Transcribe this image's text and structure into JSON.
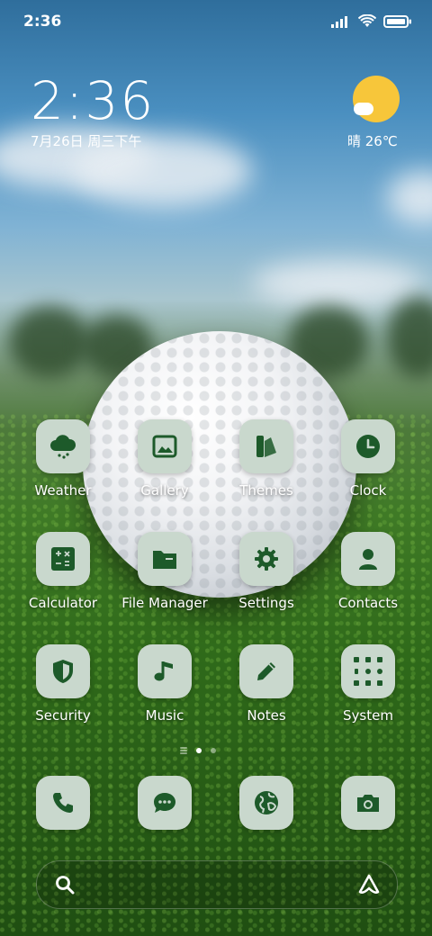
{
  "status_bar": {
    "time": "2:36"
  },
  "widget": {
    "time": "2:36",
    "date": "7月26日 周三下午",
    "weather": "晴 26℃"
  },
  "apps": [
    {
      "label": "Weather",
      "icon": "cloud-icon"
    },
    {
      "label": "Gallery",
      "icon": "image-icon"
    },
    {
      "label": "Themes",
      "icon": "palette-icon"
    },
    {
      "label": "Clock",
      "icon": "clock-icon"
    },
    {
      "label": "Calculator",
      "icon": "calculator-icon"
    },
    {
      "label": "File Manager",
      "icon": "folder-icon"
    },
    {
      "label": "Settings",
      "icon": "gear-icon"
    },
    {
      "label": "Contacts",
      "icon": "person-icon"
    },
    {
      "label": "Security",
      "icon": "shield-icon"
    },
    {
      "label": "Music",
      "icon": "music-note-icon"
    },
    {
      "label": "Notes",
      "icon": "pencil-icon"
    },
    {
      "label": "System",
      "icon": "app-folder-icon"
    }
  ],
  "dock": [
    {
      "name": "phone",
      "icon": "phone-icon"
    },
    {
      "name": "messages",
      "icon": "chat-icon"
    },
    {
      "name": "browser",
      "icon": "globe-icon"
    },
    {
      "name": "camera",
      "icon": "camera-icon"
    }
  ],
  "colors": {
    "tile_bg": "#c9d8cd",
    "icon_fg": "#1d5a2a",
    "sun": "#f7c63a"
  }
}
